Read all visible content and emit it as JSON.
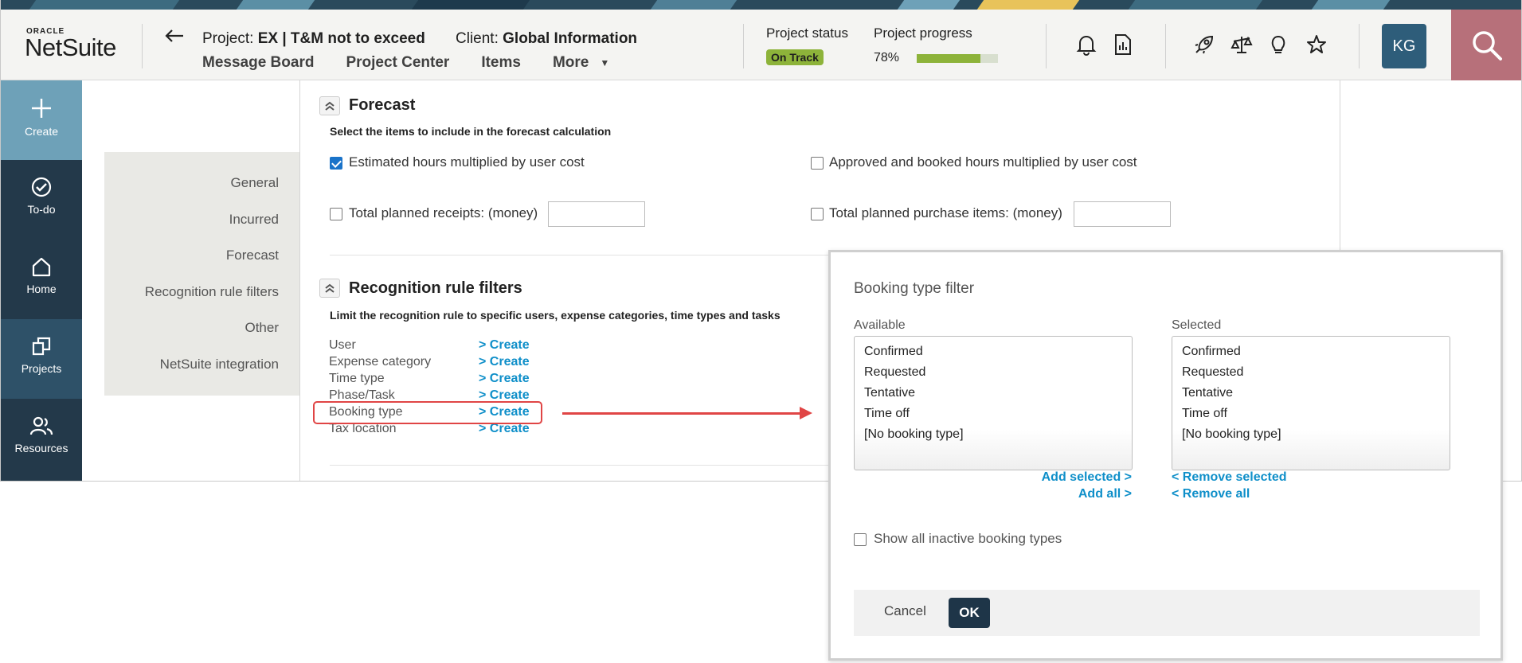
{
  "colors": {
    "accent_link": "#0f8fc9",
    "status_green": "#8db33a",
    "rail_dark": "#23394a",
    "rail_create": "#6ea1b8",
    "search_bg": "#b7707a",
    "highlight_red": "#e04545",
    "ok_button": "#1e3548"
  },
  "header": {
    "logo_oracle": "ORACLE",
    "logo_netsuite": "NetSuite",
    "back_icon": "back-arrow-icon",
    "project_prefix": "Project: ",
    "project_name": "EX | T&M not to exceed",
    "client_prefix": "Client: ",
    "client_name": "Global Information",
    "nav": [
      "Message Board",
      "Project Center",
      "Items",
      "More"
    ],
    "project_status_label": "Project  status",
    "project_status_value": "On Track",
    "project_progress_label": "Project  progress",
    "project_progress_pct": "78%",
    "progress_fraction": 0.78,
    "icons": [
      "bell-icon",
      "report-icon",
      "rocket-icon",
      "scale-icon",
      "lightbulb-icon",
      "star-icon"
    ],
    "avatar_initials": "KG",
    "search_icon": "search-icon"
  },
  "rail": [
    {
      "label": "Create",
      "icon": "plus-icon"
    },
    {
      "label": "To-do",
      "icon": "check-circle-icon"
    },
    {
      "label": "Home",
      "icon": "home-icon"
    },
    {
      "label": "Projects",
      "icon": "projects-icon"
    },
    {
      "label": "Resources",
      "icon": "people-icon"
    }
  ],
  "sidenav": [
    "General",
    "Incurred",
    "Forecast",
    "Recognition rule filters",
    "Other",
    "NetSuite integration"
  ],
  "forecast": {
    "title": "Forecast",
    "subtitle": "Select the items to include in the forecast calculation",
    "opt_est_hours": "Estimated hours multiplied by user cost",
    "opt_est_hours_checked": true,
    "opt_approved_hours": "Approved and booked hours multiplied by user cost",
    "opt_approved_hours_checked": false,
    "opt_planned_receipts": "Total planned receipts: (money)",
    "opt_planned_receipts_value": "",
    "opt_planned_purchase": "Total planned purchase items: (money)",
    "opt_planned_purchase_value": ""
  },
  "recognition": {
    "title": "Recognition rule filters",
    "subtitle": "Limit the recognition rule to specific users, expense categories, time types and tasks",
    "rows": [
      {
        "label": "User",
        "link": "> Create"
      },
      {
        "label": "Expense category",
        "link": "> Create"
      },
      {
        "label": "Time type",
        "link": "> Create"
      },
      {
        "label": "Phase/Task",
        "link": "> Create"
      },
      {
        "label": "Booking type",
        "link": "> Create"
      },
      {
        "label": "Tax location",
        "link": "> Create"
      }
    ]
  },
  "dialog": {
    "title": "Booking type filter",
    "available_label": "Available",
    "selected_label": "Selected",
    "available": [
      "Confirmed",
      "Requested",
      "Tentative",
      "Time off",
      "[No booking type]"
    ],
    "selected": [
      "Confirmed",
      "Requested",
      "Tentative",
      "Time off",
      "[No booking type]"
    ],
    "add_selected": "Add selected >",
    "add_all": "Add all >",
    "remove_selected": "< Remove selected",
    "remove_all": "< Remove all",
    "show_inactive": "Show all inactive booking types",
    "show_inactive_checked": false,
    "cancel": "Cancel",
    "ok": "OK"
  }
}
